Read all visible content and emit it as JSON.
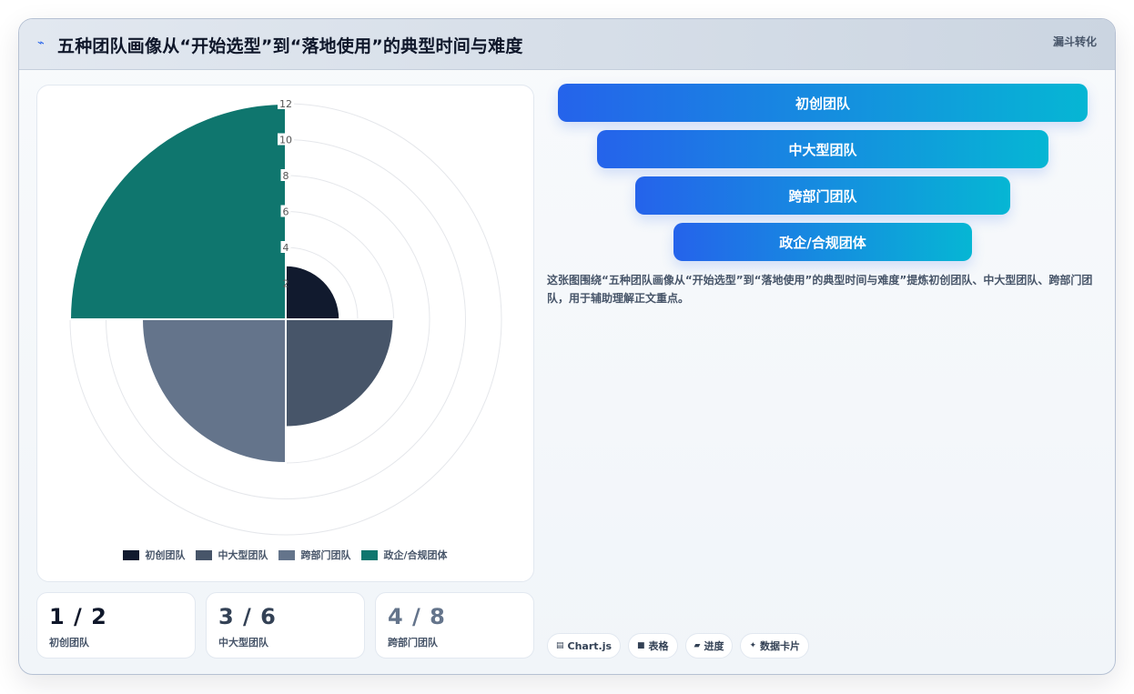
{
  "header": {
    "icon": "trend-line-icon",
    "title": "五种团队画像从“开始选型”到“落地使用”的典型时间与难度",
    "tag": "漏斗转化"
  },
  "chart_data": {
    "type": "polarArea",
    "categories": [
      "初创团队",
      "中大型团队",
      "跨部门团队",
      "政企/合规团体"
    ],
    "values": [
      3,
      6,
      8,
      12
    ],
    "colors": [
      "#111a2e",
      "#475569",
      "#64748b",
      "#0f766e"
    ],
    "r_ticks": [
      "2",
      "4",
      "6",
      "8",
      "10",
      "12"
    ],
    "rlim": [
      0,
      12
    ],
    "legend_position": "bottom",
    "grid": true
  },
  "funnel": {
    "items": [
      "初创团队",
      "中大型团队",
      "跨部门团队",
      "政企/合规团体"
    ]
  },
  "description": "这张图围绕“五种团队画像从“开始选型”到“落地使用”的典型时间与难度”提炼初创团队、中大型团队、跨部门团队，用于辅助理解正文重点。",
  "stats": [
    {
      "value": "1 / 2",
      "label": "初创团队",
      "color": "#0f172a"
    },
    {
      "value": "3 / 6",
      "label": "中大型团队",
      "color": "#334155"
    },
    {
      "value": "4 / 8",
      "label": "跨部门团队",
      "color": "#64748b"
    }
  ],
  "chips": [
    {
      "icon": "table-icon",
      "glyph": "▤",
      "label": "Chart.js"
    },
    {
      "icon": "grid-icon",
      "glyph": "■",
      "label": "表格"
    },
    {
      "icon": "progress-icon",
      "glyph": "▰",
      "label": "进度"
    },
    {
      "icon": "sparkle-icon",
      "glyph": "✦",
      "label": "数据卡片"
    }
  ]
}
